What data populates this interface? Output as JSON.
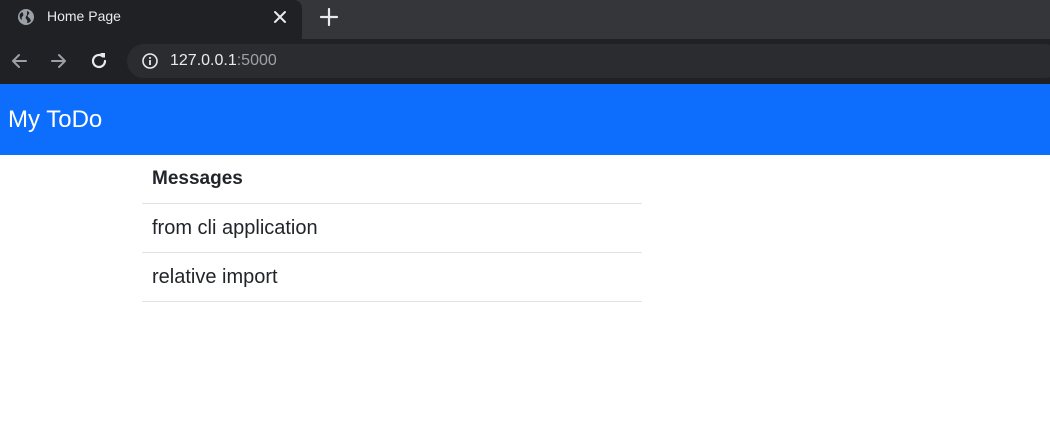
{
  "browser": {
    "tab_title": "Home Page",
    "url_host": "127.0.0.1",
    "url_port": ":5000"
  },
  "navbar": {
    "brand": "My ToDo",
    "color": "#0d6efd"
  },
  "messages_table": {
    "header": "Messages",
    "rows": [
      "from cli application",
      "relative import"
    ]
  }
}
